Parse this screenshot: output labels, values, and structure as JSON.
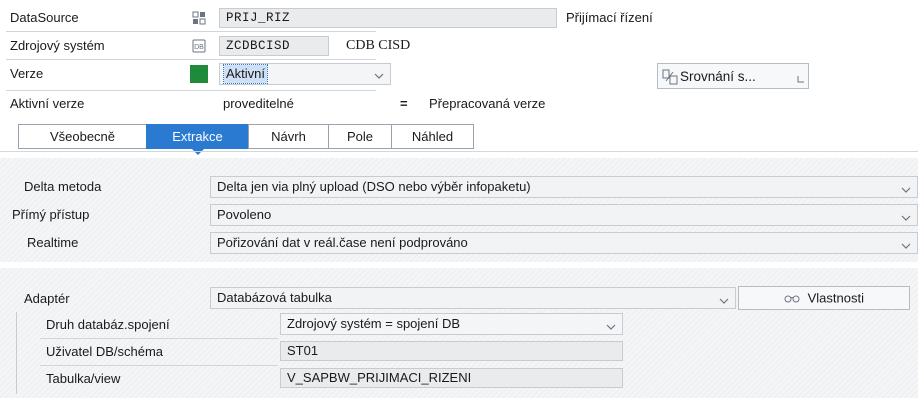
{
  "header": {
    "datasource": {
      "label": "DataSource",
      "value": "PRIJ_RIZ",
      "description": "Přijímací řízení"
    },
    "source_system": {
      "label": "Zdrojový systém",
      "value": "ZCDBCISD",
      "description": "CDB CISD"
    },
    "version": {
      "label": "Verze",
      "value": "Aktivní",
      "compare_button": "Srovnání s..."
    },
    "active_version": {
      "label": "Aktivní verze",
      "state": "proveditelné",
      "symbol": "=",
      "revised": "Přepracovaná verze"
    }
  },
  "tabs": [
    {
      "label": "Všeobecně"
    },
    {
      "label": "Extrakce"
    },
    {
      "label": "Návrh"
    },
    {
      "label": "Pole"
    },
    {
      "label": "Náhled"
    }
  ],
  "extraction": {
    "delta_method": {
      "label": "Delta metoda",
      "value": "Delta jen via plný upload (DSO nebo výběr infopaketu)"
    },
    "direct_access": {
      "label": "Přímý přístup",
      "value": "Povoleno"
    },
    "realtime": {
      "label": "Realtime",
      "value": "Pořizování dat v reál.čase není podprováno"
    }
  },
  "adapter": {
    "label": "Adaptér",
    "value": "Databázová tabulka",
    "properties_button": "Vlastnosti",
    "db_connection_type": {
      "label": "Druh databáz.spojení",
      "value": "Zdrojový systém = spojení DB"
    },
    "db_user_schema": {
      "label": "Uživatel DB/schéma",
      "value": "ST01"
    },
    "table_view": {
      "label": "Tabulka/view",
      "value": "V_SAPBW_PRIJIMACI_RIZENI"
    }
  },
  "colors": {
    "active_tab": "#2a7ad2",
    "status_green": "#1e8a3c"
  }
}
